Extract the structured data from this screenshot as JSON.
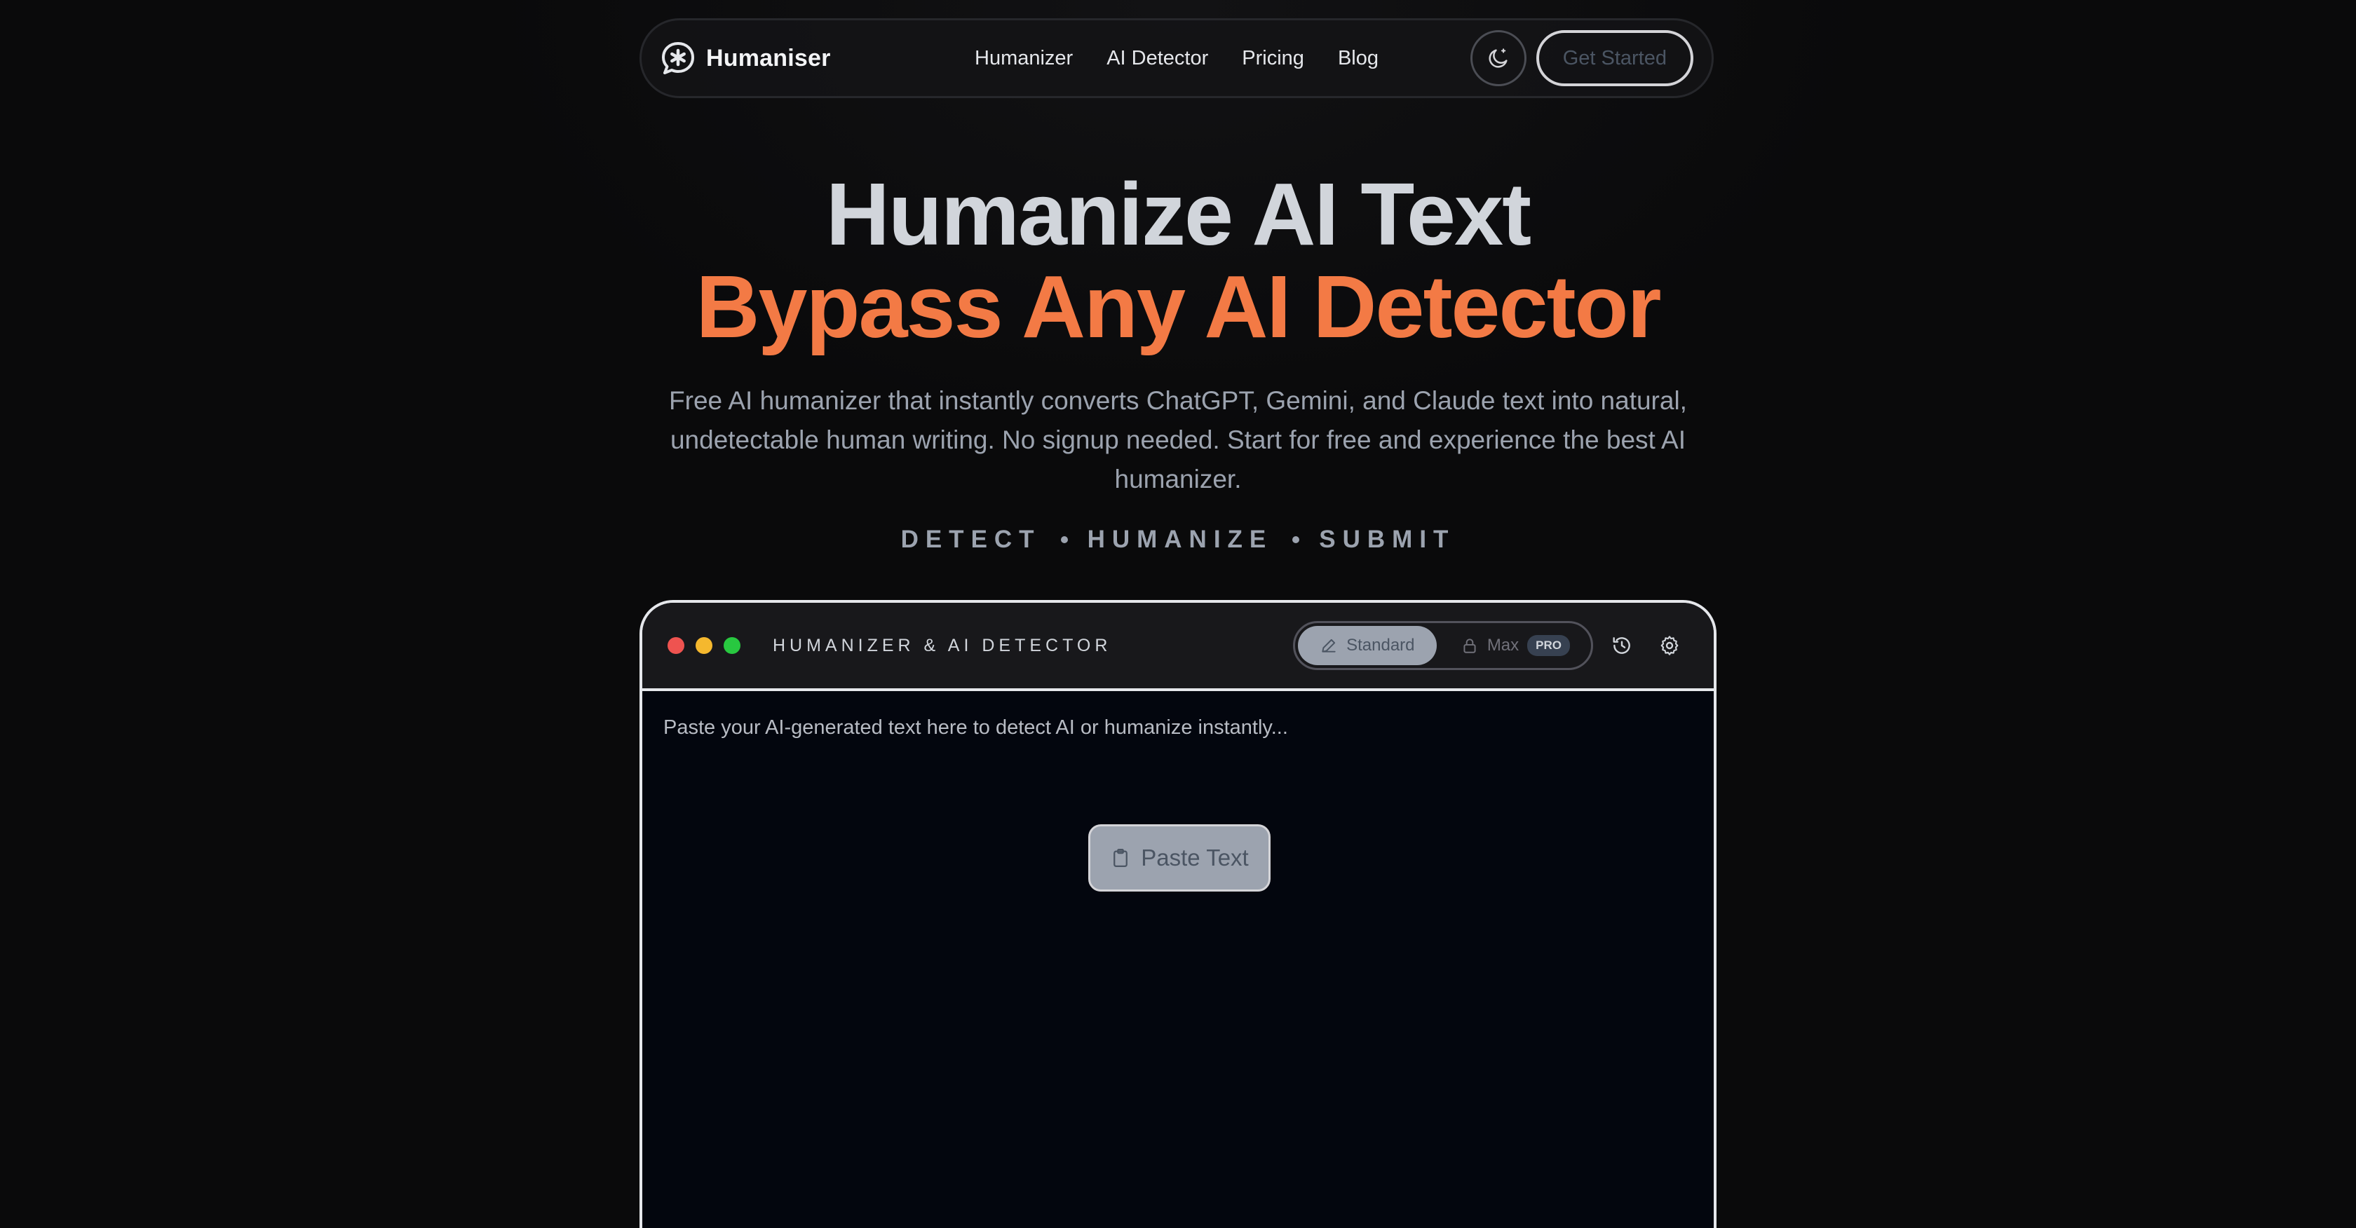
{
  "brand": {
    "name": "Humaniser",
    "icon": "asterisk-speech-bubble-icon"
  },
  "nav": {
    "links": [
      "Humanizer",
      "AI Detector",
      "Pricing",
      "Blog"
    ],
    "theme_icon": "moon-icon",
    "cta_label": "Get Started"
  },
  "hero": {
    "title_line1": "Humanize AI Text",
    "title_line2": "Bypass Any AI Detector",
    "description": "Free AI humanizer that instantly converts ChatGPT, Gemini, and Claude text into natural, undetectable human writing. No signup needed. Start for free and experience the best AI humanizer.",
    "steps": [
      "DETECT",
      "HUMANIZE",
      "SUBMIT"
    ]
  },
  "tool": {
    "title": "HUMANIZER & AI DETECTOR",
    "modes": {
      "standard_label": "Standard",
      "max_label": "Max",
      "pro_badge": "PRO",
      "selected": "Standard"
    },
    "editor_placeholder": "Paste your AI-generated text here to detect AI or humanize instantly...",
    "editor_value": "",
    "paste_label": "Paste Text"
  },
  "colors": {
    "accent_orange": "#f37a45",
    "traffic_red": "#ef5350",
    "traffic_yellow": "#f5b82e",
    "traffic_green": "#28c840"
  }
}
